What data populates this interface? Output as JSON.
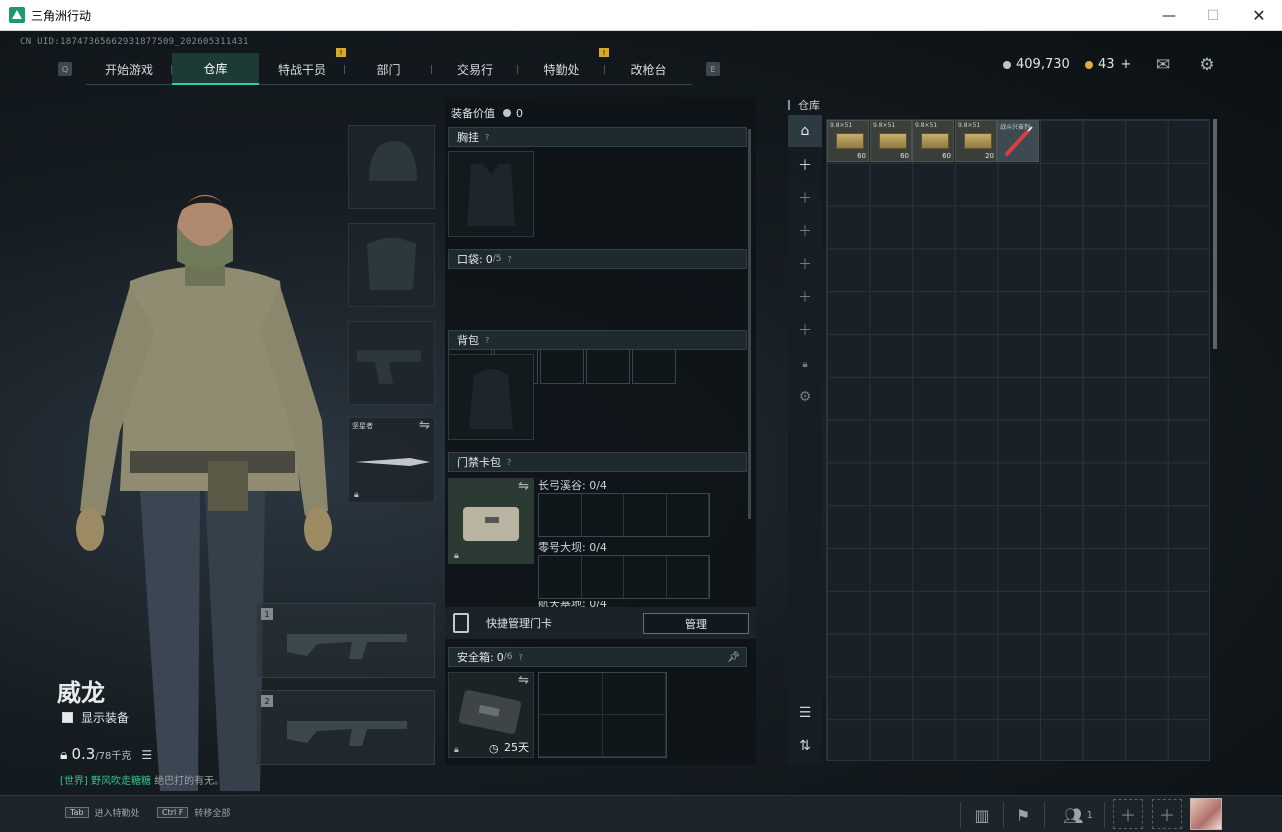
{
  "window": {
    "title": "三角洲行动",
    "minimize": "—",
    "maximize": "☐",
    "close": "✕"
  },
  "uid": "CN UID:1874736566293187750​9_202605311431",
  "nav": {
    "left_key": "Q",
    "right_key": "E",
    "tabs": [
      "开始游戏",
      "仓库",
      "特战干员",
      "部门",
      "交易行",
      "特勤处",
      "改枪台"
    ],
    "active": "仓库",
    "badge": "!"
  },
  "currency": {
    "silver": "409,730",
    "gold": "43",
    "gold_plus": "+"
  },
  "character": {
    "name": "威龙",
    "show_gear_label": "显示装备",
    "weight_value": "0.3",
    "weight_max": "/78千克",
    "chat_channel": "[世界]",
    "chat_user": "野风吹走糖糖",
    "chat_message": "绝巴打的有无。"
  },
  "melee": {
    "name": "坚星者"
  },
  "gun_slots": [
    {
      "num": "1"
    },
    {
      "num": "2"
    }
  ],
  "equipment": {
    "value_label": "装备价值",
    "value": "0",
    "chest_rig": "胸挂",
    "pockets_label": "口袋:",
    "pockets_used": "0",
    "pockets_total": "/5",
    "backpack": "背包",
    "keycard_case": "门禁卡包",
    "key_areas": [
      {
        "label": "长弓溪谷: 0/4"
      },
      {
        "label": "零号大坝: 0/4"
      },
      {
        "label": "航天基地: 0/4"
      }
    ],
    "quick_manage": "快捷管理门卡",
    "manage_button": "管理",
    "safe_label": "安全箱:",
    "safe_used": "0",
    "safe_total": "/6",
    "safe_days": "25天",
    "help": "?"
  },
  "inventory": {
    "title": "仓库",
    "items": [
      {
        "label": "9.8×51",
        "count": "60"
      },
      {
        "label": "9.8×51",
        "count": "60"
      },
      {
        "label": "9.8×51",
        "count": "60"
      },
      {
        "label": "9.8×51",
        "count": "20"
      },
      {
        "label": "战斗兴奋剂",
        "count": ""
      }
    ]
  },
  "bottom": {
    "hint1_key": "Tab",
    "hint1": "进入特勤处",
    "hint2_key": "Ctrl F",
    "hint2": "转移全部",
    "squad_count": "1"
  }
}
